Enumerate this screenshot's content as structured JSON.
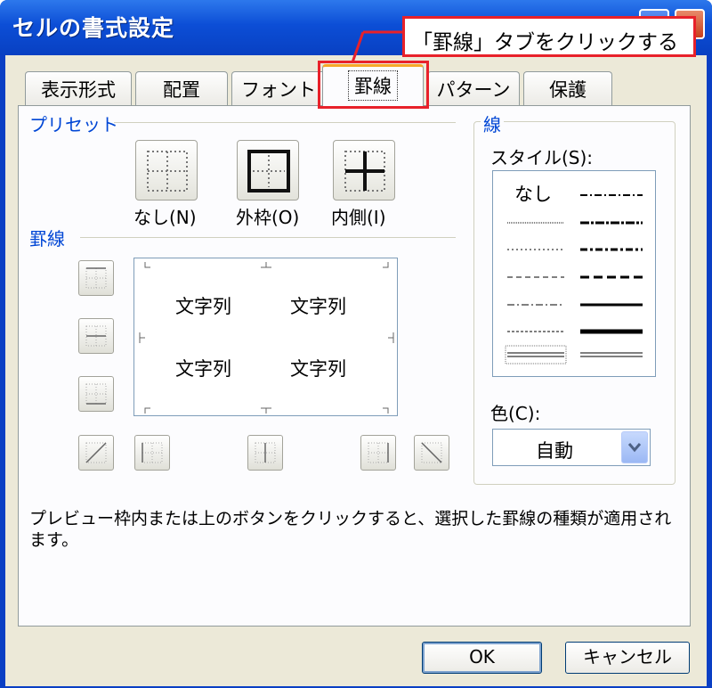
{
  "window": {
    "title": "セルの書式設定"
  },
  "tabs": [
    {
      "label": "表示形式"
    },
    {
      "label": "配置"
    },
    {
      "label": "フォント"
    },
    {
      "label": "罫線"
    },
    {
      "label": "パターン"
    },
    {
      "label": "保護"
    }
  ],
  "active_tab": "罫線",
  "presets": {
    "group_label": "プリセット",
    "items": [
      {
        "label": "なし(N)",
        "icon": "border-none-icon"
      },
      {
        "label": "外枠(O)",
        "icon": "border-outline-icon"
      },
      {
        "label": "内側(I)",
        "icon": "border-inside-icon"
      }
    ]
  },
  "border": {
    "group_label": "罫線",
    "preview_texts": [
      "文字列",
      "文字列",
      "文字列",
      "文字列"
    ]
  },
  "line": {
    "group_label": "線",
    "style_label": "スタイル(S):",
    "style_none": "なし",
    "color_label": "色(C):",
    "color_value": "自動"
  },
  "description": "プレビュー枠内または上のボタンをクリックすると、選択した罫線の種類が適用されます。",
  "buttons": {
    "ok": "OK",
    "cancel": "キャンセル"
  },
  "annotation": {
    "callout_text": "「罫線」タブをクリックする",
    "color": "#e8212a"
  }
}
